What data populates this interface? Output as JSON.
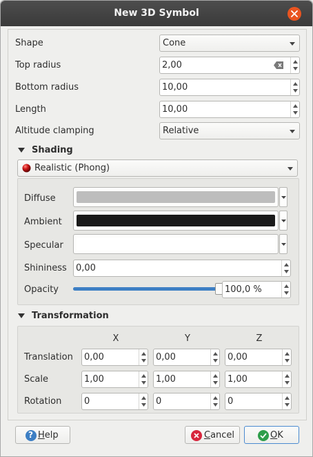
{
  "window": {
    "title": "New 3D Symbol"
  },
  "form": {
    "shape": {
      "label": "Shape",
      "value": "Cone"
    },
    "top_radius": {
      "label": "Top radius",
      "value": "2,00"
    },
    "bottom_radius": {
      "label": "Bottom radius",
      "value": "10,00"
    },
    "length": {
      "label": "Length",
      "value": "10,00"
    },
    "altitude_clamping": {
      "label": "Altitude clamping",
      "value": "Relative"
    }
  },
  "shading": {
    "header": "Shading",
    "model": "Realistic (Phong)",
    "diffuse": {
      "label": "Diffuse",
      "color": "#bdbdbd"
    },
    "ambient": {
      "label": "Ambient",
      "color": "#1a1a1a"
    },
    "specular": {
      "label": "Specular",
      "color": "#ffffff"
    },
    "shininess": {
      "label": "Shininess",
      "value": "0,00"
    },
    "opacity": {
      "label": "Opacity",
      "value": "100,0 %",
      "fraction": 1.0
    }
  },
  "transformation": {
    "header": "Transformation",
    "axes": [
      "X",
      "Y",
      "Z"
    ],
    "rows": [
      {
        "label": "Translation",
        "values": [
          "0,00",
          "0,00",
          "0,00"
        ]
      },
      {
        "label": "Scale",
        "values": [
          "1,00",
          "1,00",
          "1,00"
        ]
      },
      {
        "label": "Rotation",
        "values": [
          "0",
          "0",
          "0"
        ]
      }
    ]
  },
  "buttons": {
    "help": {
      "label": "Help",
      "underline": "H",
      "rest": "elp"
    },
    "cancel": {
      "label": "Cancel",
      "underline": "C",
      "rest": "ancel"
    },
    "ok": {
      "label": "OK",
      "underline": "O",
      "rest": "K"
    }
  },
  "colors": {
    "titlebar": "#3a3a3a",
    "close_button": "#e95420",
    "accent": "#3d7fc4",
    "help_icon": "#3d7fc4",
    "cancel_icon": "#d7263d",
    "ok_icon": "#2e9e4b"
  },
  "icons": [
    "close-icon",
    "chevron-down-icon",
    "clear-icon",
    "spin-up-icon",
    "spin-down-icon",
    "collapse-triangle-icon",
    "red-sphere-icon",
    "help-icon",
    "cancel-icon",
    "ok-icon"
  ]
}
